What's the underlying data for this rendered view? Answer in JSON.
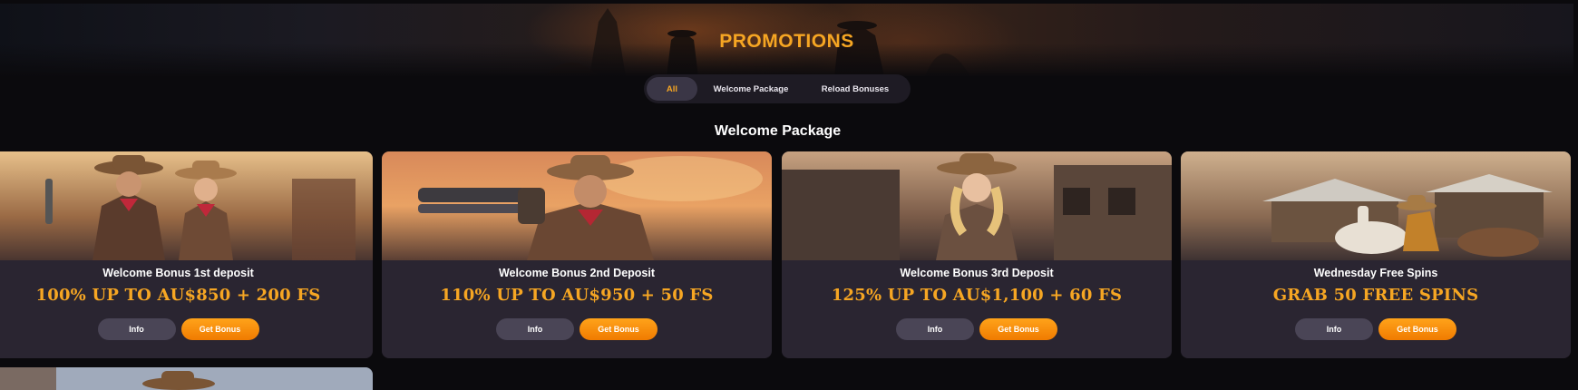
{
  "header": {
    "title": "PROMOTIONS"
  },
  "tabs": [
    {
      "label": "All",
      "active": true
    },
    {
      "label": "Welcome Package",
      "active": false
    },
    {
      "label": "Reload Bonuses",
      "active": false
    }
  ],
  "section": {
    "title": "Welcome Package"
  },
  "cards": [
    {
      "label": "Welcome Bonus 1st deposit",
      "offer": "100% UP TO AU$850 + 200 FS",
      "info": "Info",
      "cta": "Get Bonus"
    },
    {
      "label": "Welcome Bonus 2nd Deposit",
      "offer": "110% UP TO AU$950 + 50 FS",
      "info": "Info",
      "cta": "Get Bonus"
    },
    {
      "label": "Welcome Bonus 3rd Deposit",
      "offer": "125% UP TO AU$1,100 + 60 FS",
      "info": "Info",
      "cta": "Get Bonus"
    },
    {
      "label": "Wednesday Free Spins",
      "offer": "GRAB 50 FREE SPINS",
      "info": "Info",
      "cta": "Get Bonus"
    }
  ],
  "colors": {
    "accent": "#f6a623",
    "cta": "#f58a07",
    "card_bg": "#2a2531",
    "page_bg": "#0b0a0d"
  }
}
